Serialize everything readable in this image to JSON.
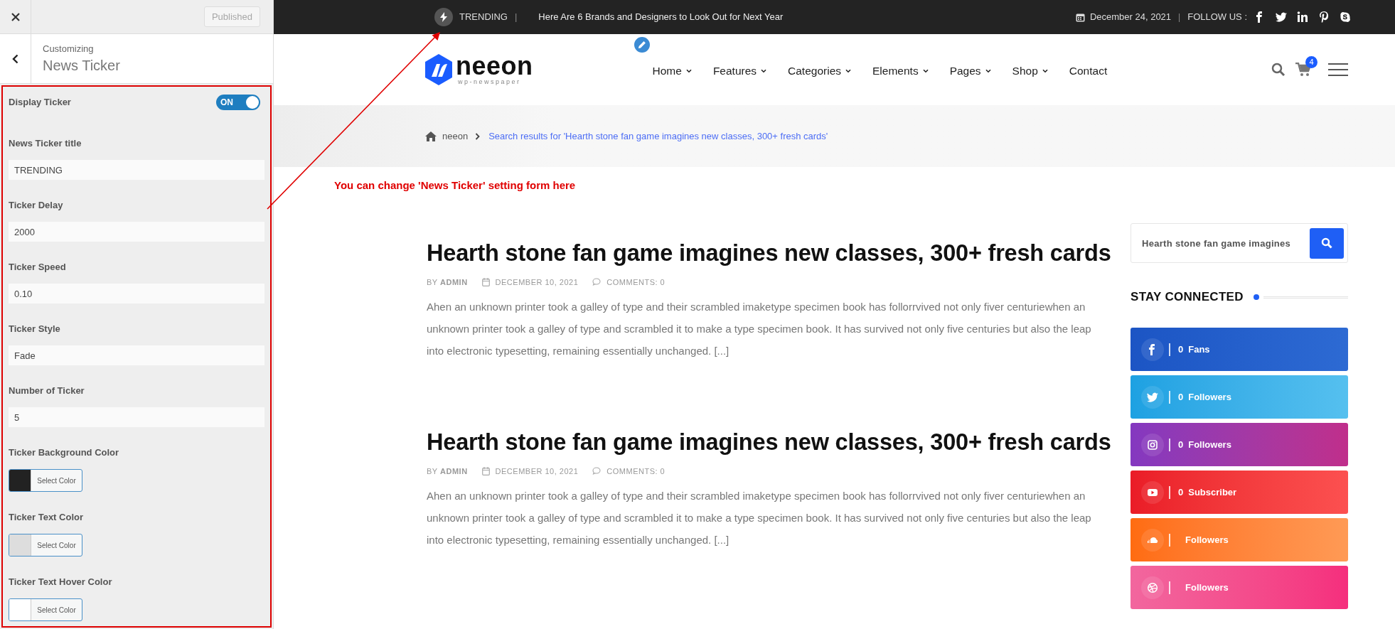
{
  "customizer": {
    "publish_button": "Published",
    "context": "Customizing",
    "section_title": "News Ticker",
    "controls": [
      {
        "kind": "toggle",
        "label": "Display Ticker",
        "on": true,
        "state_label": "ON"
      },
      {
        "kind": "text",
        "label": "News Ticker title",
        "value": "TRENDING"
      },
      {
        "kind": "text",
        "label": "Ticker Delay",
        "value": "2000"
      },
      {
        "kind": "text",
        "label": "Ticker Speed",
        "value": "0.10"
      },
      {
        "kind": "text",
        "label": "Ticker Style",
        "value": "Fade"
      },
      {
        "kind": "text",
        "label": "Number of Ticker",
        "value": "5"
      },
      {
        "kind": "color",
        "label": "Ticker Background Color",
        "color": "#222222",
        "button": "Select Color"
      },
      {
        "kind": "color",
        "label": "Ticker Text Color",
        "color": "#dddddd",
        "button": "Select Color"
      },
      {
        "kind": "color",
        "label": "Ticker Text Hover Color",
        "color": "#ffffff",
        "button": "Select Color"
      }
    ]
  },
  "annotation": "You can change 'News Ticker' setting form here",
  "site": {
    "ticker": {
      "title": "TRENDING",
      "separator": "|",
      "headline": "Here Are 6 Brands and Designers to Look Out for Next Year"
    },
    "date": "December 24, 2021",
    "divider": "|",
    "follow_label": "FOLLOW US :",
    "logo": {
      "name": "neeon",
      "tagline": "wp-newspaper"
    },
    "menu": [
      {
        "label": "Home",
        "dropdown": true
      },
      {
        "label": "Features",
        "dropdown": true
      },
      {
        "label": "Categories",
        "dropdown": true
      },
      {
        "label": "Elements",
        "dropdown": true
      },
      {
        "label": "Pages",
        "dropdown": true
      },
      {
        "label": "Shop",
        "dropdown": true
      },
      {
        "label": "Contact",
        "dropdown": false
      }
    ],
    "cart_count": "4",
    "breadcrumb": {
      "home": "neeon",
      "current": "Search results for 'Hearth stone fan game imagines new classes, 300+ fresh cards'"
    },
    "posts": [
      {
        "title": "Hearth stone fan game imagines new classes, 300+ fresh cards",
        "byline": "BY **ADMIN**",
        "date": "DECEMBER 10, 2021",
        "comments": "COMMENTS: 0",
        "excerpt": "Ahen an unknown printer took a galley of type and their scrambled imaketype specimen book has follorrvived not only fiver centuriewhen an unknown printer took a galley of type and scrambled it to make a type specimen book. It has survived not only five centuries but also the leap into electronic typesetting, remaining essentially unchanged. [...]"
      },
      {
        "title": "Hearth stone fan game imagines new classes, 300+ fresh cards",
        "byline": "BY **ADMIN**",
        "date": "DECEMBER 10, 2021",
        "comments": "COMMENTS: 0",
        "excerpt": "Ahen an unknown printer took a galley of type and their scrambled imaketype specimen book has follorrvived not only fiver centuriewhen an unknown printer took a galley of type and scrambled it to make a type specimen book. It has survived not only five centuries but also the leap into electronic typesetting, remaining essentially unchanged. [...]"
      }
    ],
    "sidebar": {
      "search_value": "Hearth stone fan game imagines",
      "heading": "STAY CONNECTED",
      "social": [
        {
          "kind": "facebook",
          "count": "0",
          "label": "Fans"
        },
        {
          "kind": "twitter",
          "count": "0",
          "label": "Followers"
        },
        {
          "kind": "instagram",
          "count": "0",
          "label": "Followers"
        },
        {
          "kind": "youtube",
          "count": "0",
          "label": "Subscriber"
        },
        {
          "kind": "soundcloud",
          "label": "Followers"
        },
        {
          "kind": "dribbble",
          "label": "Followers"
        }
      ]
    }
  }
}
